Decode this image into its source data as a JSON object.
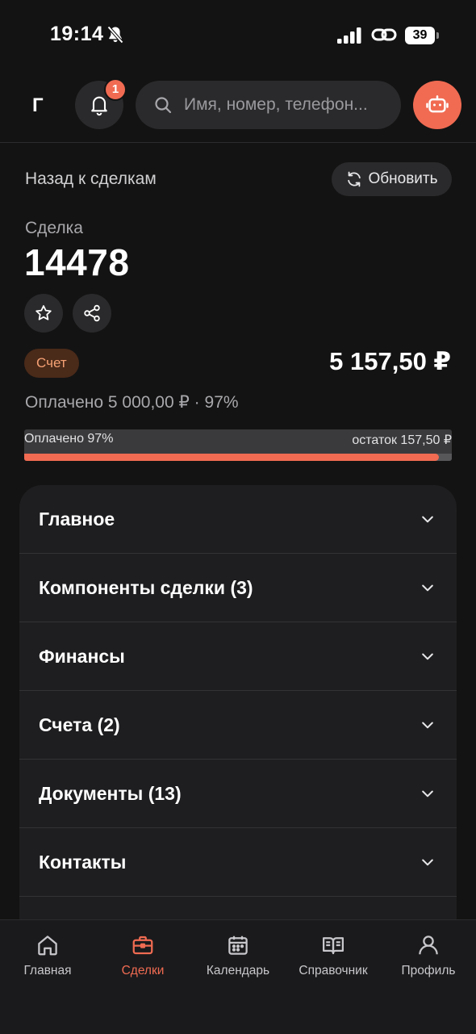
{
  "status_bar": {
    "time": "19:14",
    "battery": "39"
  },
  "header": {
    "letter": "Г",
    "notifications_count": "1",
    "search_placeholder": "Имя, номер, телефон..."
  },
  "deal": {
    "back_label": "Назад к сделкам",
    "refresh_label": "Обновить",
    "label": "Сделка",
    "number": "14478",
    "chip": "Счет",
    "amount": "5 157,50 ₽",
    "paid_summary": "Оплачено 5 000,00 ₽ · 97%",
    "progress": {
      "left_label": "Оплачено 97%",
      "right_label": "остаток 157,50 ₽",
      "percent": 97
    }
  },
  "sections": [
    {
      "title": "Главное"
    },
    {
      "title": "Компоненты сделки (3)"
    },
    {
      "title": "Финансы"
    },
    {
      "title": "Счета (2)"
    },
    {
      "title": "Документы (13)"
    },
    {
      "title": "Контакты"
    }
  ],
  "tabs": [
    {
      "label": "Главная",
      "icon": "home-icon"
    },
    {
      "label": "Сделки",
      "icon": "briefcase-icon",
      "active": true
    },
    {
      "label": "Календарь",
      "icon": "calendar-icon"
    },
    {
      "label": "Справочник",
      "icon": "book-icon"
    },
    {
      "label": "Профиль",
      "icon": "user-icon"
    }
  ],
  "colors": {
    "accent": "#f06b52",
    "background": "#131313",
    "surface": "#1e1e20",
    "chip_bg": "#4a2a19",
    "chip_text": "#f6a274"
  }
}
